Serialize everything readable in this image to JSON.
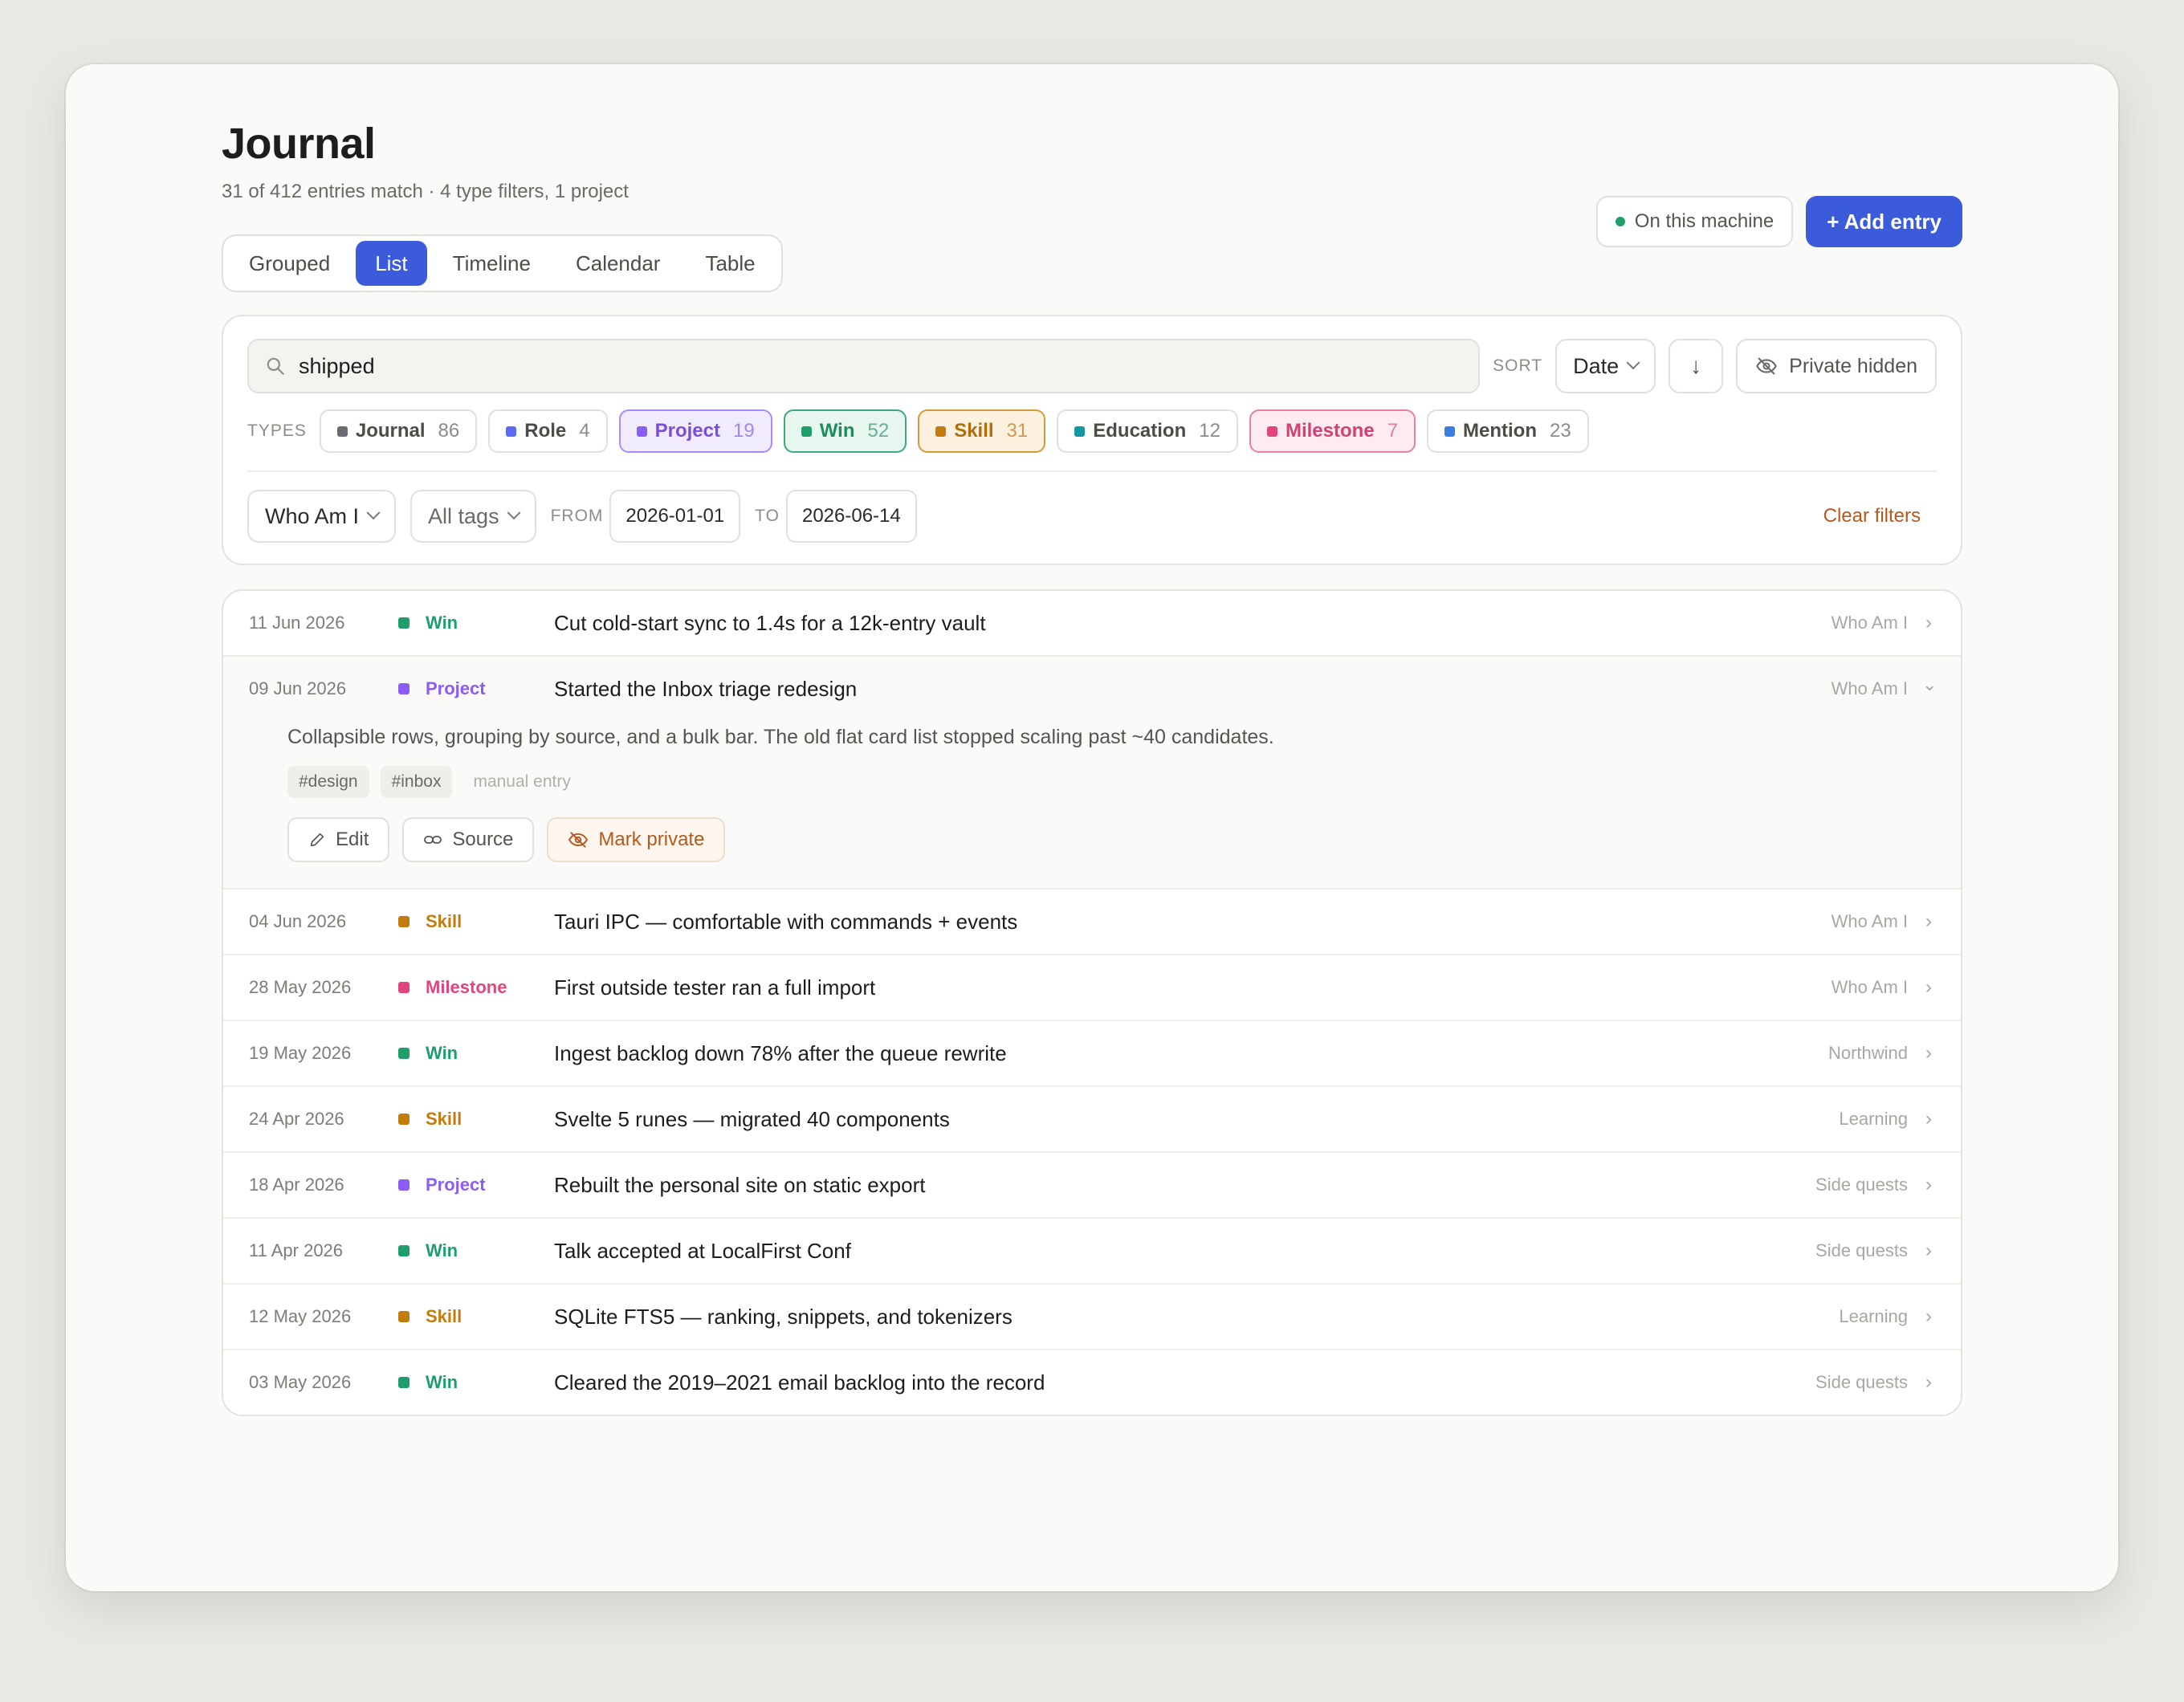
{
  "header": {
    "title": "Journal",
    "subtitle": "31 of 412 entries match · 4 type filters, 1 project",
    "machine_status": "On this machine",
    "add_button": "+ Add entry"
  },
  "view_tabs": [
    {
      "label": "Grouped",
      "active": false
    },
    {
      "label": "List",
      "active": true
    },
    {
      "label": "Timeline",
      "active": false
    },
    {
      "label": "Calendar",
      "active": false
    },
    {
      "label": "Table",
      "active": false
    }
  ],
  "filters": {
    "search_value": "shipped",
    "sort_label": "SORT",
    "sort_value": "Date",
    "sort_direction": "↓",
    "private_toggle": "Private hidden",
    "types_label": "TYPES",
    "types": [
      {
        "name": "Journal",
        "count": "86",
        "color": "#6b6a70",
        "active": false
      },
      {
        "name": "Role",
        "count": "4",
        "color": "#5b6cf0",
        "active": false
      },
      {
        "name": "Project",
        "count": "19",
        "color": "#8b5cf6",
        "active": true,
        "bg": "#f1ecfd",
        "border": "#a78bfa",
        "text": "#7c4ddb"
      },
      {
        "name": "Win",
        "count": "52",
        "color": "#1f9d6b",
        "active": true,
        "bg": "#e7f6ef",
        "border": "#3fa97c",
        "text": "#1f8c60"
      },
      {
        "name": "Skill",
        "count": "31",
        "color": "#c27c0e",
        "active": true,
        "bg": "#fcf1de",
        "border": "#d79a3a",
        "text": "#b06d0a"
      },
      {
        "name": "Education",
        "count": "12",
        "color": "#1596a3",
        "active": false
      },
      {
        "name": "Milestone",
        "count": "7",
        "color": "#e0457b",
        "active": true,
        "bg": "#fdebf1",
        "border": "#ec7ea3",
        "text": "#d2416f"
      },
      {
        "name": "Mention",
        "count": "23",
        "color": "#3b7de0",
        "active": false
      }
    ],
    "project_select": "Who Am I",
    "tags_select": "All tags",
    "from_label": "FROM",
    "from_date": "2026-01-01",
    "to_label": "TO",
    "to_date": "2026-06-14",
    "clear_filters": "Clear filters"
  },
  "entries": [
    {
      "date": "11 Jun 2026",
      "type": "Win",
      "color": "#1f9d6b",
      "title": "Cut cold-start sync to 1.4s for a 12k-entry vault",
      "source": "Who Am I",
      "expanded": false
    },
    {
      "date": "09 Jun 2026",
      "type": "Project",
      "color": "#8b5cf6",
      "title": "Started the Inbox triage redesign",
      "source": "Who Am I",
      "expanded": true
    },
    {
      "date": "04 Jun 2026",
      "type": "Skill",
      "color": "#c27c0e",
      "title": "Tauri IPC — comfortable with commands + events",
      "source": "Who Am I",
      "expanded": false
    },
    {
      "date": "28 May 2026",
      "type": "Milestone",
      "color": "#e0457b",
      "title": "First outside tester ran a full import",
      "source": "Who Am I",
      "expanded": false
    },
    {
      "date": "19 May 2026",
      "type": "Win",
      "color": "#1f9d6b",
      "title": "Ingest backlog down 78% after the queue rewrite",
      "source": "Northwind",
      "expanded": false
    },
    {
      "date": "24 Apr 2026",
      "type": "Skill",
      "color": "#c27c0e",
      "title": "Svelte 5 runes — migrated 40 components",
      "source": "Learning",
      "expanded": false
    },
    {
      "date": "18 Apr 2026",
      "type": "Project",
      "color": "#8b5cf6",
      "title": "Rebuilt the personal site on static export",
      "source": "Side quests",
      "expanded": false
    },
    {
      "date": "11 Apr 2026",
      "type": "Win",
      "color": "#1f9d6b",
      "title": "Talk accepted at LocalFirst Conf",
      "source": "Side quests",
      "expanded": false
    },
    {
      "date": "12 May 2026",
      "type": "Skill",
      "color": "#c27c0e",
      "title": "SQLite FTS5 — ranking, snippets, and tokenizers",
      "source": "Learning",
      "expanded": false
    },
    {
      "date": "03 May 2026",
      "type": "Win",
      "color": "#1f9d6b",
      "title": "Cleared the 2019–2021 email backlog into the record",
      "source": "Side quests",
      "expanded": false
    }
  ],
  "expanded_detail": {
    "text": "Collapsible rows, grouping by source, and a bulk bar. The old flat card list stopped scaling past ~40 candidates.",
    "tags": [
      "#design",
      "#inbox"
    ],
    "origin": "manual entry",
    "actions": {
      "edit": "Edit",
      "source": "Source",
      "mark_private": "Mark private"
    }
  }
}
